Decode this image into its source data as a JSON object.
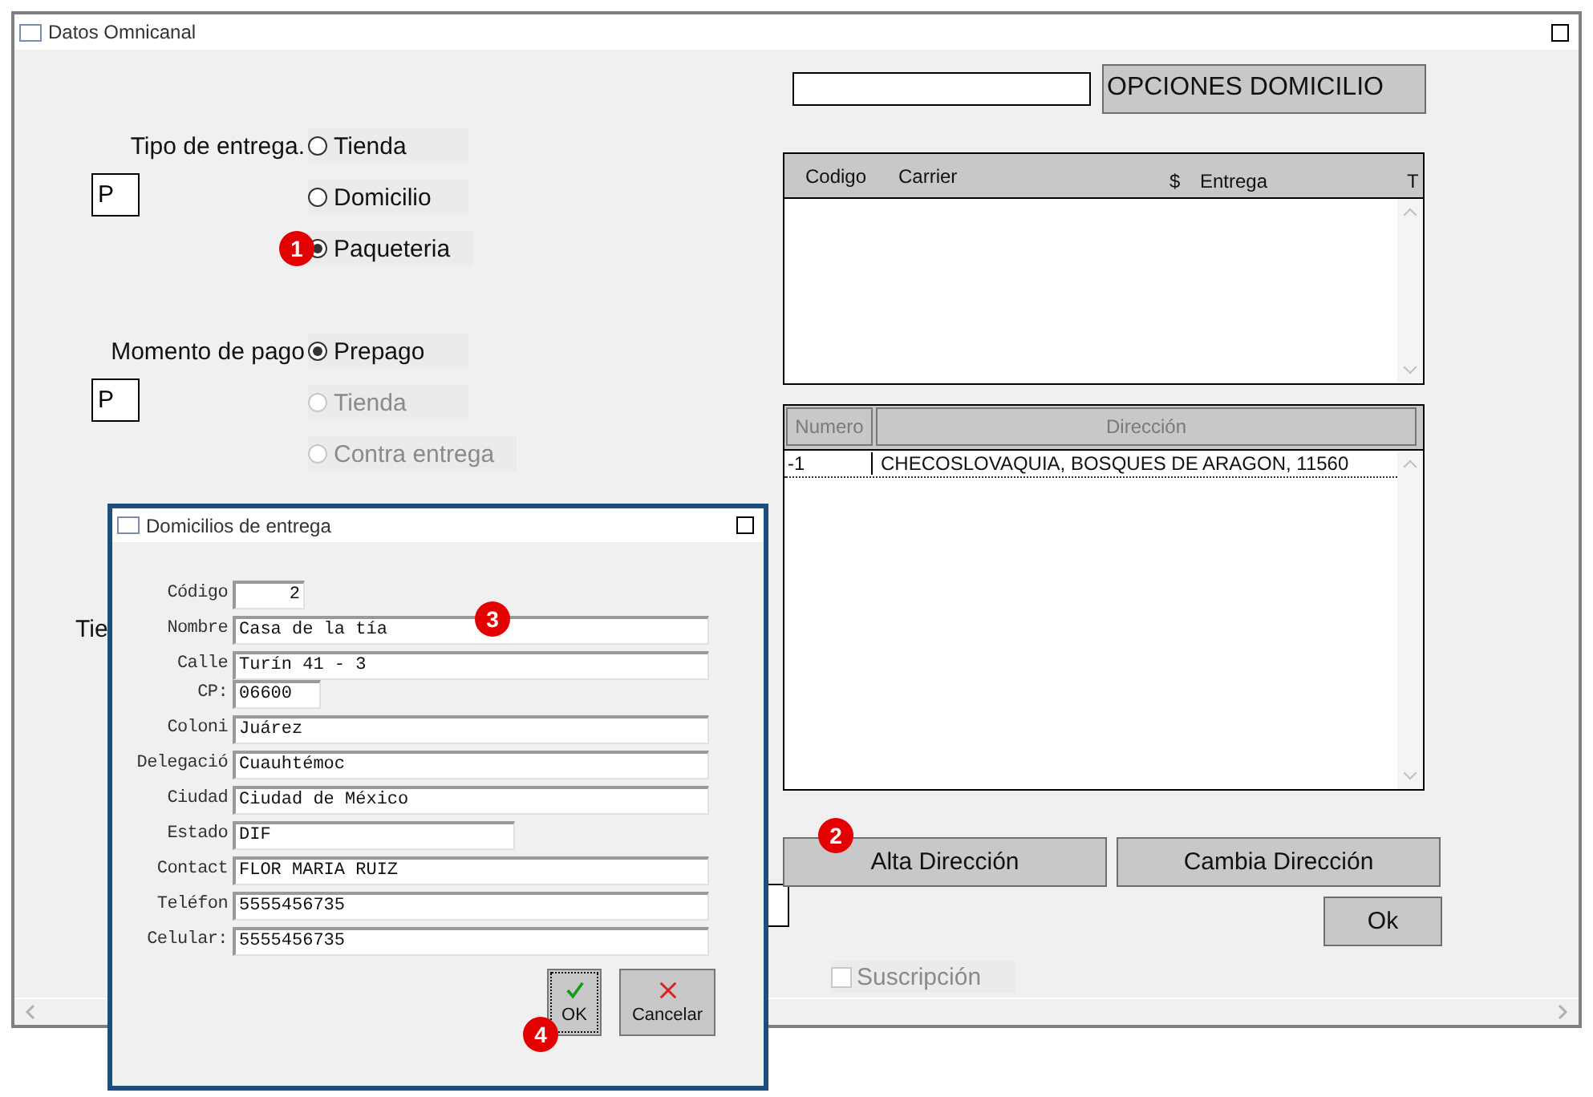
{
  "window": {
    "title": "Datos Omnicanal"
  },
  "delivery_type": {
    "label": "Tipo de entrega.",
    "code": "P",
    "options": [
      {
        "label": "Tienda",
        "selected": false,
        "disabled": false
      },
      {
        "label": "Domicilio",
        "selected": false,
        "disabled": false
      },
      {
        "label": "Paqueteria",
        "selected": true,
        "disabled": false,
        "badge": "1"
      }
    ]
  },
  "payment_moment": {
    "label": "Momento de pago",
    "code": "P",
    "options": [
      {
        "label": "Prepago",
        "selected": true,
        "disabled": false
      },
      {
        "label": "Tienda",
        "selected": false,
        "disabled": true
      },
      {
        "label": "Contra entrega",
        "selected": false,
        "disabled": true
      }
    ]
  },
  "partial_label": "Tie",
  "options_button": {
    "label": "OPCIONES DOMICILIO"
  },
  "options_table": {
    "columns": [
      "Codigo",
      "Carrier",
      "$",
      "Entrega",
      "T"
    ]
  },
  "address_table": {
    "columns": [
      {
        "label": "Numero",
        "dimmed": true
      },
      {
        "label": "Dirección",
        "dimmed": true
      }
    ],
    "rows": [
      {
        "cells": [
          "-1",
          "CHECOSLOVAQUIA, BOSQUES DE ARAGON, 11560"
        ],
        "focused": true
      }
    ]
  },
  "address_buttons": [
    {
      "label": "Alta Dirección",
      "badge": "2"
    },
    {
      "label": "Cambia Dirección"
    }
  ],
  "ok_button": {
    "label": "Ok"
  },
  "subscription": {
    "label": "Suscripción",
    "checked": false,
    "disabled": true
  },
  "dialog": {
    "title": "Domicilios de entrega",
    "fields": [
      {
        "label": "Código",
        "value": "2",
        "kind": "number"
      },
      {
        "label": "Nombre",
        "value": "Casa de la tía",
        "kind": "long",
        "badge": "3"
      },
      {
        "label": "Calle",
        "value": "Turín 41 - 3",
        "kind": "long"
      },
      {
        "label": "CP:",
        "value": "06600",
        "kind": "short"
      },
      {
        "label": "Coloni",
        "value": "Juárez",
        "kind": "long"
      },
      {
        "label": "Delegació",
        "value": "Cuauhtémoc",
        "kind": "long"
      },
      {
        "label": "Ciudad",
        "value": "Ciudad de México",
        "kind": "long"
      },
      {
        "label": "Estado",
        "value": "DIF",
        "kind": "medium"
      },
      {
        "label": "Contact",
        "value": "FLOR MARIA RUIZ",
        "kind": "long"
      },
      {
        "label": "Teléfon",
        "value": "5555456735",
        "kind": "long"
      },
      {
        "label": "Celular:",
        "value": "5555456735",
        "kind": "long"
      }
    ],
    "buttons": [
      {
        "label": "OK",
        "kind": "ok",
        "focused": true,
        "badge": "4"
      },
      {
        "label": "Cancelar",
        "kind": "cancel",
        "focused": false
      }
    ]
  }
}
